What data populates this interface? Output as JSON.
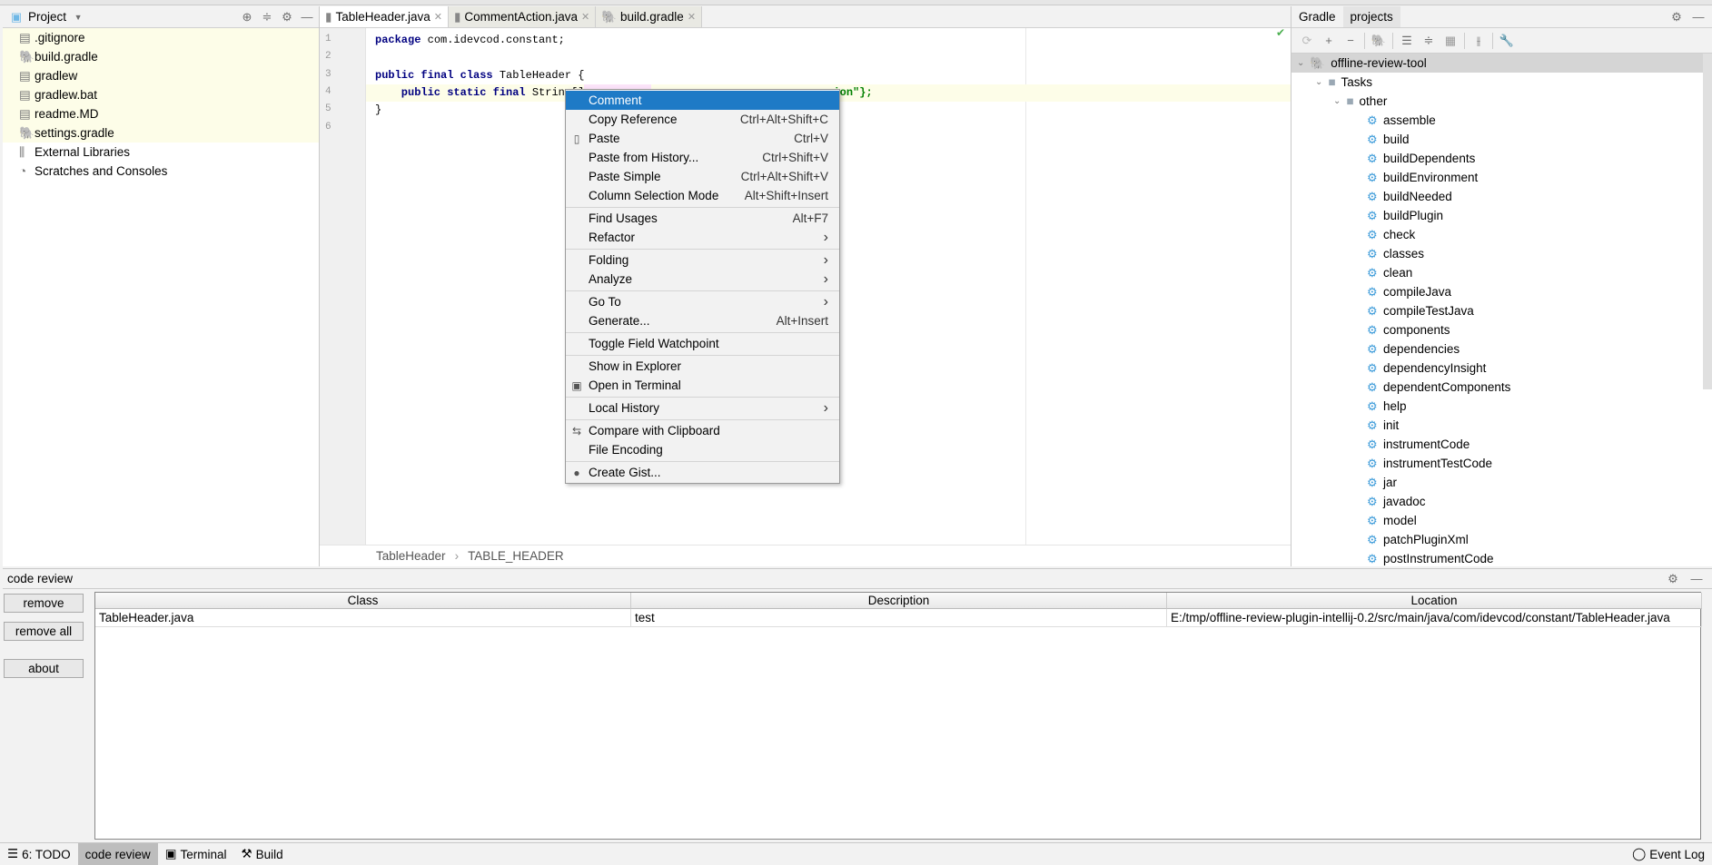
{
  "project": {
    "title": "Project",
    "items": [
      {
        "label": ".gitignore",
        "icon": "file-icon",
        "hl": true
      },
      {
        "label": "build.gradle",
        "icon": "gradle-icon",
        "hl": true
      },
      {
        "label": "gradlew",
        "icon": "file-icon",
        "hl": true
      },
      {
        "label": "gradlew.bat",
        "icon": "file-icon",
        "hl": true
      },
      {
        "label": "readme.MD",
        "icon": "file-icon",
        "hl": true
      },
      {
        "label": "settings.gradle",
        "icon": "gradle-icon",
        "hl": true
      },
      {
        "label": "External Libraries",
        "icon": "library-icon",
        "hl": false
      },
      {
        "label": "Scratches and Consoles",
        "icon": "scratches-icon",
        "hl": false
      }
    ]
  },
  "editor": {
    "tabs": [
      {
        "label": "TableHeader.java",
        "active": true
      },
      {
        "label": "CommentAction.java",
        "active": false
      },
      {
        "label": "build.gradle",
        "active": false
      }
    ],
    "line_numbers": [
      "1",
      "2",
      "3",
      "4",
      "5",
      "6"
    ],
    "code": {
      "l1_kw": "package",
      "l1_rest": " com.idevcod.constant;",
      "l3_kw": "public final class",
      "l3_rest": " TableHeader {",
      "l4_kw": "    public static final",
      "l4_rest": " String[]",
      "l4_tail": "ion\"};",
      "l5": "}"
    },
    "breadcrumb": [
      "TableHeader",
      "TABLE_HEADER"
    ]
  },
  "context_menu": {
    "groups": [
      [
        {
          "label": "Comment",
          "selected": true
        },
        {
          "label": "Copy Reference",
          "shortcut": "Ctrl+Alt+Shift+C"
        },
        {
          "label": "Paste",
          "shortcut": "Ctrl+V",
          "icon": "clipboard-icon"
        },
        {
          "label": "Paste from History...",
          "shortcut": "Ctrl+Shift+V"
        },
        {
          "label": "Paste Simple",
          "shortcut": "Ctrl+Alt+Shift+V"
        },
        {
          "label": "Column Selection Mode",
          "shortcut": "Alt+Shift+Insert"
        }
      ],
      [
        {
          "label": "Find Usages",
          "shortcut": "Alt+F7"
        },
        {
          "label": "Refactor",
          "submenu": true
        }
      ],
      [
        {
          "label": "Folding",
          "submenu": true
        },
        {
          "label": "Analyze",
          "submenu": true
        }
      ],
      [
        {
          "label": "Go To",
          "submenu": true
        },
        {
          "label": "Generate...",
          "shortcut": "Alt+Insert"
        }
      ],
      [
        {
          "label": "Toggle Field Watchpoint"
        }
      ],
      [
        {
          "label": "Show in Explorer"
        },
        {
          "label": "Open in Terminal",
          "icon": "terminal-icon"
        }
      ],
      [
        {
          "label": "Local History",
          "submenu": true
        }
      ],
      [
        {
          "label": "Compare with Clipboard",
          "icon": "compare-icon"
        },
        {
          "label": "File Encoding"
        }
      ],
      [
        {
          "label": "Create Gist...",
          "icon": "github-icon"
        }
      ]
    ]
  },
  "gradle": {
    "tabs": [
      "Gradle",
      "projects"
    ],
    "root": "offline-review-tool",
    "tasks_label": "Tasks",
    "group": "other",
    "tasks": [
      "assemble",
      "build",
      "buildDependents",
      "buildEnvironment",
      "buildNeeded",
      "buildPlugin",
      "check",
      "classes",
      "clean",
      "compileJava",
      "compileTestJava",
      "components",
      "dependencies",
      "dependencyInsight",
      "dependentComponents",
      "help",
      "init",
      "instrumentCode",
      "instrumentTestCode",
      "jar",
      "javadoc",
      "model",
      "patchPluginXml",
      "postInstrumentCode"
    ]
  },
  "review": {
    "title": "code review",
    "buttons": {
      "remove": "remove",
      "remove_all": "remove all",
      "about": "about"
    },
    "columns": [
      "Class",
      "Description",
      "Location"
    ],
    "rows": [
      [
        "TableHeader.java",
        "test",
        "E:/tmp/offline-review-plugin-intellij-0.2/src/main/java/com/idevcod/constant/TableHeader.java"
      ]
    ]
  },
  "statusbar": {
    "items": [
      {
        "label": "6: TODO",
        "icon": "list-icon"
      },
      {
        "label": "code review",
        "active": true
      },
      {
        "label": "Terminal",
        "icon": "terminal-icon"
      },
      {
        "label": "Build",
        "icon": "hammer-icon"
      }
    ],
    "event_log": "Event Log"
  },
  "colors": {
    "selection": "#1e7ac6",
    "highlight_rows": "#fdfde8",
    "gear": "#3a9ad9"
  }
}
